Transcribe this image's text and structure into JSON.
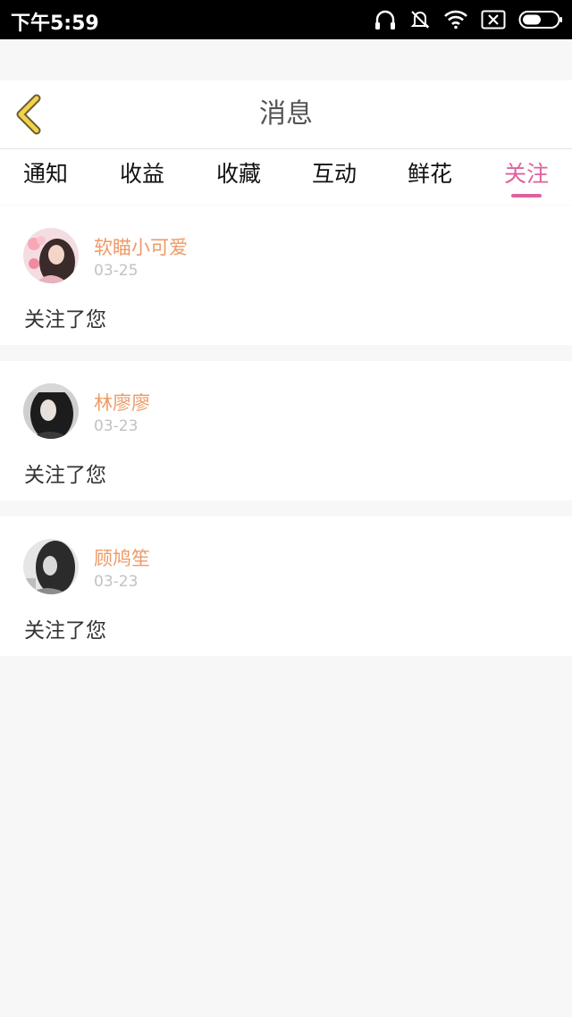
{
  "status_bar": {
    "time": "下午5:59"
  },
  "header": {
    "title": "消息"
  },
  "tabs": [
    {
      "label": "通知",
      "active": false
    },
    {
      "label": "收益",
      "active": false
    },
    {
      "label": "收藏",
      "active": false
    },
    {
      "label": "互动",
      "active": false
    },
    {
      "label": "鲜花",
      "active": false
    },
    {
      "label": "关注",
      "active": true
    }
  ],
  "colors": {
    "accent": "#e0609d",
    "name": "#ee9a66",
    "back_icon": "#f2d24b"
  },
  "messages": [
    {
      "name": "软瞄小可爱",
      "date": "03-25",
      "text": "关注了您"
    },
    {
      "name": "林廖廖",
      "date": "03-23",
      "text": "关注了您"
    },
    {
      "name": "顾鸠笙",
      "date": "03-23",
      "text": "关注了您"
    }
  ]
}
